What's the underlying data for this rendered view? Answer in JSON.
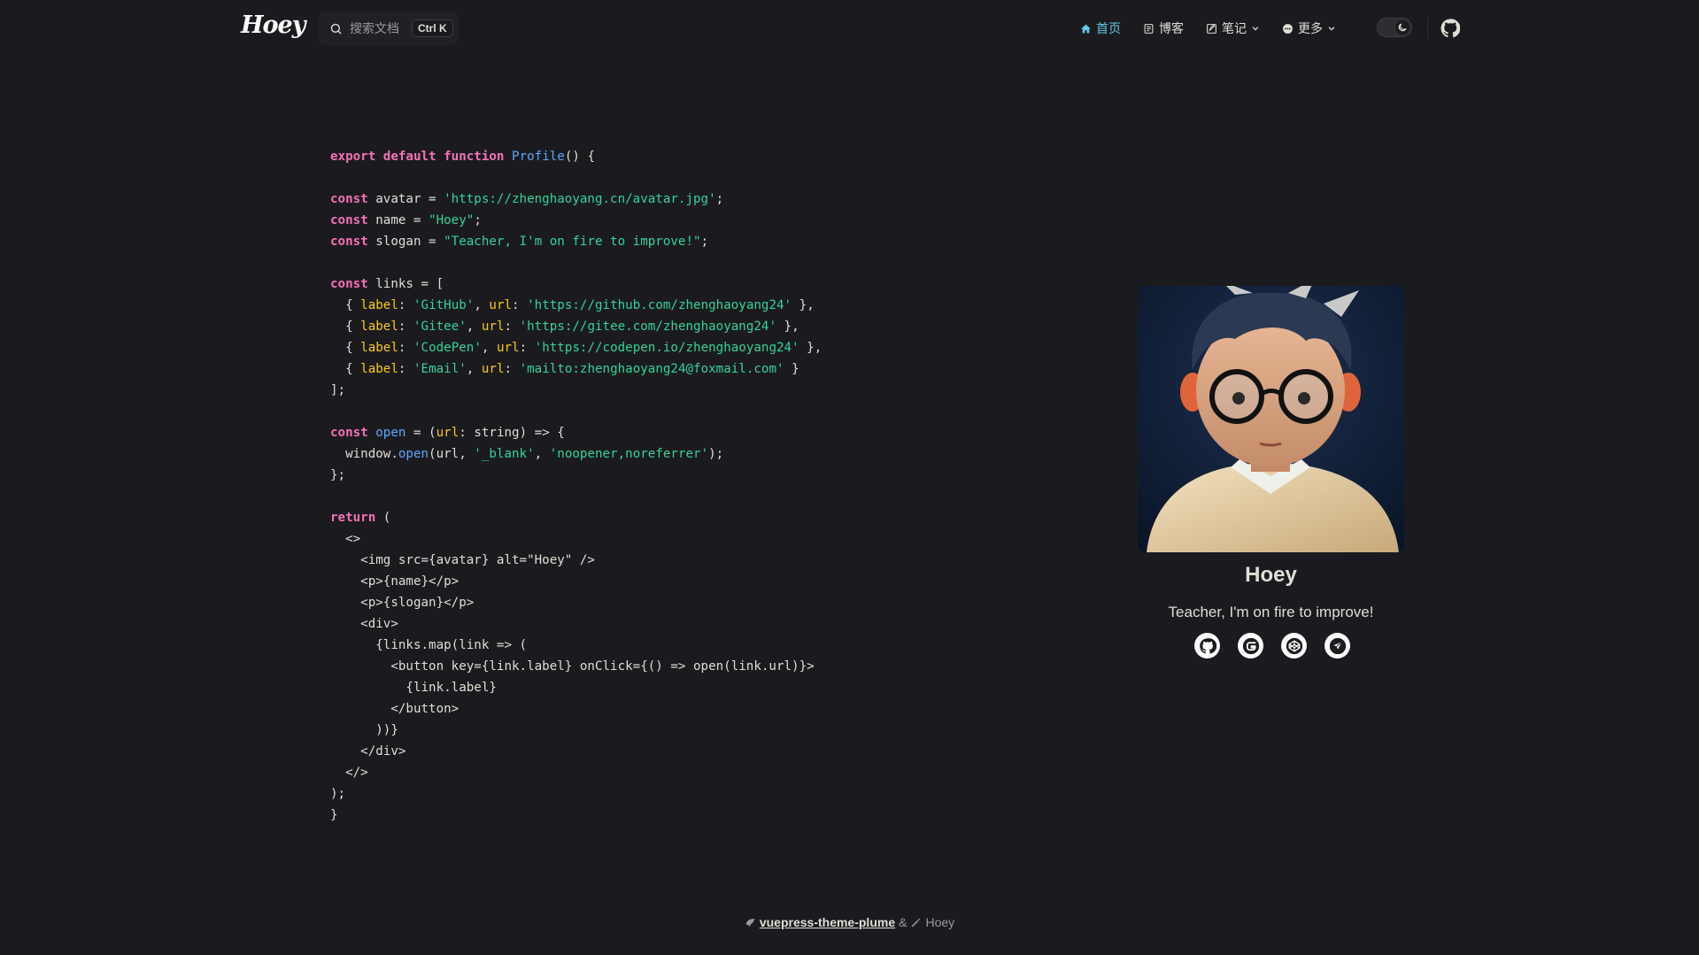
{
  "header": {
    "brand": "Hoey",
    "search_placeholder": "搜索文档",
    "search_shortcut": "Ctrl K",
    "menu": [
      {
        "label": "首页",
        "icon": "home-icon",
        "active": true
      },
      {
        "label": "博客",
        "icon": "blog-icon"
      },
      {
        "label": "笔记",
        "icon": "notes-icon",
        "dropdown": true
      },
      {
        "label": "更多",
        "icon": "more-icon",
        "dropdown": true
      }
    ],
    "theme": "dark"
  },
  "code_lines": [
    [
      [
        "kw",
        "export"
      ],
      [
        "t",
        " "
      ],
      [
        "kw",
        "default"
      ],
      [
        "t",
        " "
      ],
      [
        "kw",
        "function"
      ],
      [
        "t",
        " "
      ],
      [
        "fn",
        "Profile"
      ],
      [
        "t",
        "() {"
      ]
    ],
    [],
    [
      [
        "kw",
        "const"
      ],
      [
        "t",
        " avatar = "
      ],
      [
        "str",
        "'https://zhenghaoyang.cn/avatar.jpg'"
      ],
      [
        "t",
        ";"
      ]
    ],
    [
      [
        "kw",
        "const"
      ],
      [
        "t",
        " name = "
      ],
      [
        "str",
        "\"Hoey\""
      ],
      [
        "t",
        ";"
      ]
    ],
    [
      [
        "kw",
        "const"
      ],
      [
        "t",
        " slogan = "
      ],
      [
        "str",
        "\"Teacher, I'm on fire to improve!\""
      ],
      [
        "t",
        ";"
      ]
    ],
    [],
    [
      [
        "kw",
        "const"
      ],
      [
        "t",
        " links = ["
      ]
    ],
    [
      [
        "t",
        "  { "
      ],
      [
        "prop",
        "label"
      ],
      [
        "t",
        ": "
      ],
      [
        "str",
        "'GitHub'"
      ],
      [
        "t",
        ", "
      ],
      [
        "prop",
        "url"
      ],
      [
        "t",
        ": "
      ],
      [
        "str",
        "'https://github.com/zhenghaoyang24'"
      ],
      [
        "t",
        " },"
      ]
    ],
    [
      [
        "t",
        "  { "
      ],
      [
        "prop",
        "label"
      ],
      [
        "t",
        ": "
      ],
      [
        "str",
        "'Gitee'"
      ],
      [
        "t",
        ", "
      ],
      [
        "prop",
        "url"
      ],
      [
        "t",
        ": "
      ],
      [
        "str",
        "'https://gitee.com/zhenghaoyang24'"
      ],
      [
        "t",
        " },"
      ]
    ],
    [
      [
        "t",
        "  { "
      ],
      [
        "prop",
        "label"
      ],
      [
        "t",
        ": "
      ],
      [
        "str",
        "'CodePen'"
      ],
      [
        "t",
        ", "
      ],
      [
        "prop",
        "url"
      ],
      [
        "t",
        ": "
      ],
      [
        "str",
        "'https://codepen.io/zhenghaoyang24'"
      ],
      [
        "t",
        " },"
      ]
    ],
    [
      [
        "t",
        "  { "
      ],
      [
        "prop",
        "label"
      ],
      [
        "t",
        ": "
      ],
      [
        "str",
        "'Email'"
      ],
      [
        "t",
        ", "
      ],
      [
        "prop",
        "url"
      ],
      [
        "t",
        ": "
      ],
      [
        "str",
        "'mailto:zhenghaoyang24@foxmail.com'"
      ],
      [
        "t",
        " }"
      ]
    ],
    [
      [
        "t",
        "];"
      ]
    ],
    [],
    [
      [
        "kw",
        "const"
      ],
      [
        "t",
        " "
      ],
      [
        "fn",
        "open"
      ],
      [
        "t",
        " = ("
      ],
      [
        "prop",
        "url"
      ],
      [
        "t",
        ": string) => {"
      ]
    ],
    [
      [
        "t",
        "  window."
      ],
      [
        "fn",
        "open"
      ],
      [
        "t",
        "(url, "
      ],
      [
        "str",
        "'_blank'"
      ],
      [
        "t",
        ", "
      ],
      [
        "str",
        "'noopener,noreferrer'"
      ],
      [
        "t",
        ");"
      ]
    ],
    [
      [
        "t",
        "};"
      ]
    ],
    [],
    [
      [
        "kw",
        "return"
      ],
      [
        "t",
        " ("
      ]
    ],
    [
      [
        "t",
        "  <>"
      ]
    ],
    [
      [
        "t",
        "    <img src={avatar} alt=\"Hoey\" />"
      ]
    ],
    [
      [
        "t",
        "    <p>{name}</p>"
      ]
    ],
    [
      [
        "t",
        "    <p>{slogan}</p>"
      ]
    ],
    [
      [
        "t",
        "    <div>"
      ]
    ],
    [
      [
        "t",
        "      {links.map(link => ("
      ]
    ],
    [
      [
        "t",
        "        <button key={link.label} onClick={() => open(link.url)}>"
      ]
    ],
    [
      [
        "t",
        "          {link.label}"
      ]
    ],
    [
      [
        "t",
        "        </button>"
      ]
    ],
    [
      [
        "t",
        "      ))}"
      ]
    ],
    [
      [
        "t",
        "    </div>"
      ]
    ],
    [
      [
        "t",
        "  </>"
      ]
    ],
    [
      [
        "t",
        ");"
      ]
    ],
    [
      [
        "t",
        "}"
      ]
    ]
  ],
  "profile": {
    "name": "Hoey",
    "slogan": "Teacher, I'm on fire to improve!",
    "links": [
      {
        "icon": "github-icon"
      },
      {
        "icon": "gitee-icon"
      },
      {
        "icon": "codepen-icon"
      },
      {
        "icon": "email-icon"
      }
    ]
  },
  "footer": {
    "theme_link": "vuepress-theme-plume",
    "separator": "&",
    "author": "Hoey"
  },
  "colors": {
    "background": "#1b1b1f",
    "accent": "#5fc9e6",
    "keyword": "#f472b6",
    "function": "#60a5fa",
    "string": "#34d399",
    "property": "#facc15"
  }
}
